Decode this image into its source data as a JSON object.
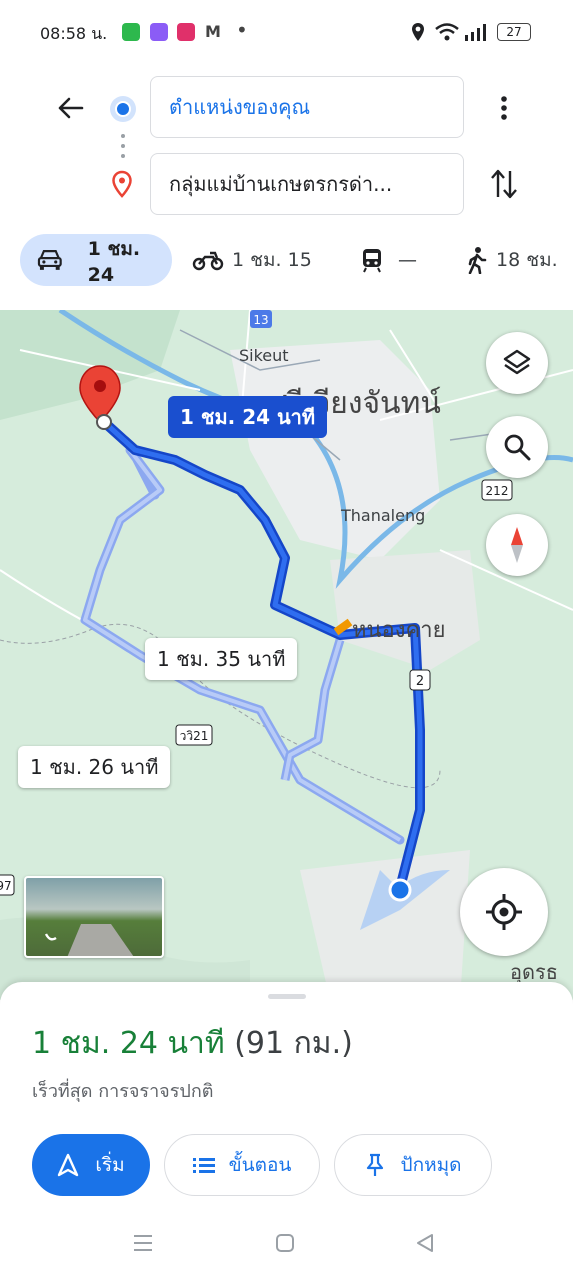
{
  "status_bar": {
    "time": "08:58 น.",
    "battery": "27"
  },
  "directions": {
    "origin": "ตำแหน่งของคุณ",
    "destination": "กลุ่มแม่บ้านเกษตรกรด่า..."
  },
  "modes": [
    {
      "icon": "car-icon",
      "label": "1 ชม. 24",
      "selected": true
    },
    {
      "icon": "motorcycle-icon",
      "label": "1 ชม. 15",
      "selected": false
    },
    {
      "icon": "transit-icon",
      "label": "—",
      "selected": false
    },
    {
      "icon": "walk-icon",
      "label": "18 ชม.",
      "selected": false
    }
  ],
  "map": {
    "selected_route_label": "1 ชม. 24 นาที",
    "alt_route_1_label": "1 ชม. 35 นาที",
    "alt_route_2_label": "1 ชม. 26 นาที",
    "places": {
      "sikeut": "Sikeut",
      "thanaleng": "Thanaleng",
      "vientiane": "ศรีเวียงจันทน์",
      "nongkhai": "หนองคาย",
      "udon": "อุดรธ"
    },
    "road_shields": {
      "r13": "13",
      "r212": "212",
      "r2": "2",
      "r21": "ววิ21",
      "r7": "97"
    }
  },
  "summary": {
    "duration": "1 ชม. 24 นาที",
    "distance": "(91 กม.)",
    "note": "เร็วที่สุด การจราจรปกติ"
  },
  "actions": {
    "start": "เริ่ม",
    "steps": "ขั้นตอน",
    "pin": "ปักหมุด"
  },
  "colors": {
    "accent": "#1a73e8",
    "route": "#1a4fcf",
    "duration_green": "#188038",
    "pin_red": "#ea4335"
  }
}
